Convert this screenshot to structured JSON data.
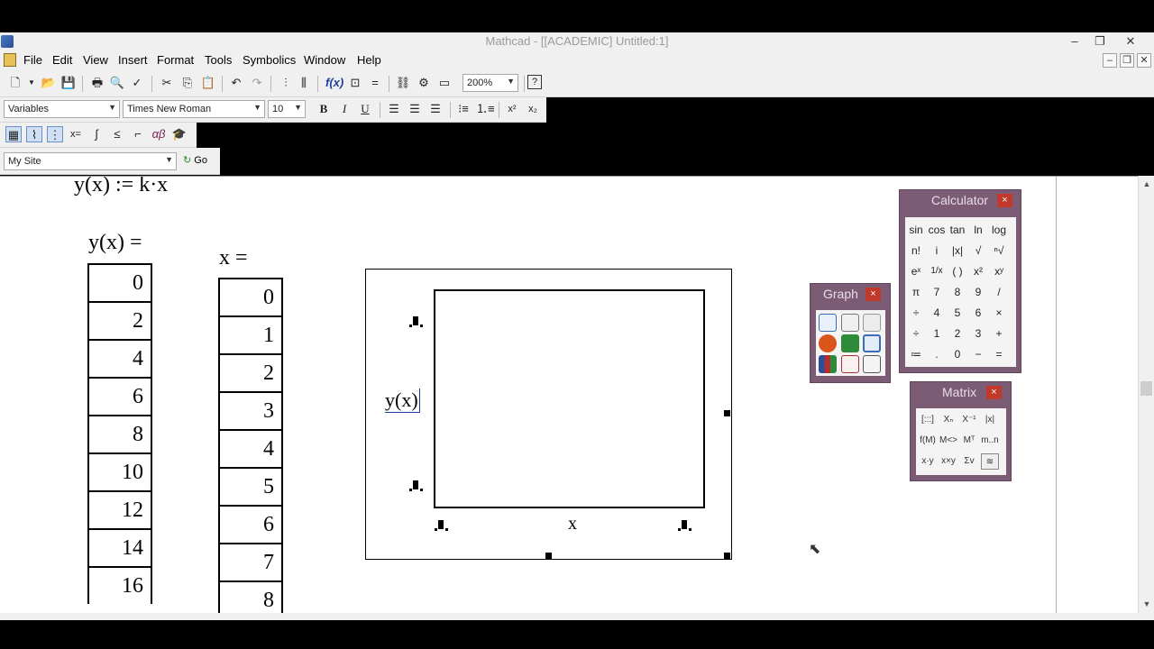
{
  "window": {
    "title": "Mathcad - [[ACADEMIC] Untitled:1]"
  },
  "menubar": {
    "items": [
      "File",
      "Edit",
      "View",
      "Insert",
      "Format",
      "Tools",
      "Symbolics",
      "Window",
      "Help"
    ]
  },
  "toolbar": {
    "zoom": "200%"
  },
  "formatting": {
    "style": "Variables",
    "font": "Times New Roman",
    "size": "10",
    "bold": "B",
    "italic": "I",
    "underline": "U"
  },
  "math_toolbar": {
    "items": [
      "calculator-icon",
      "graph-toolbar-icon",
      "matrix-toolbar-icon",
      "evaluation-icon",
      "calculus-icon",
      "boolean-icon",
      "programming-icon",
      "greek-icon",
      "symbolic-icon"
    ]
  },
  "resources": {
    "site": "My Site",
    "go_label": "Go"
  },
  "worksheet": {
    "definition": "y(x) := k·x",
    "y_eval_label": "y(x) =",
    "x_eval_label": "x =",
    "y_values": [
      "0",
      "2",
      "4",
      "6",
      "8",
      "10",
      "12",
      "14",
      "16"
    ],
    "x_values": [
      "0",
      "1",
      "2",
      "3",
      "4",
      "5",
      "6",
      "7",
      "8"
    ],
    "graph": {
      "y_axis_expr": "y(x)",
      "x_axis_expr": "x"
    }
  },
  "palettes": {
    "calculator": {
      "title": "Calculator",
      "rows": [
        [
          "sin",
          "cos",
          "tan",
          "ln",
          "log"
        ],
        [
          "n!",
          "i",
          "|x|",
          "√",
          "ⁿ√"
        ],
        [
          "eˣ",
          "1/x",
          "( )",
          "x²",
          "xʸ"
        ],
        [
          "π",
          "7",
          "8",
          "9",
          "/"
        ],
        [
          "÷",
          "4",
          "5",
          "6",
          "×"
        ],
        [
          "÷",
          "1",
          "2",
          "3",
          "+"
        ],
        [
          "≔",
          ".",
          "0",
          "−",
          "="
        ]
      ]
    },
    "graph": {
      "title": "Graph"
    },
    "matrix": {
      "title": "Matrix",
      "rows": [
        [
          "[:::]",
          "Xₙ",
          "X⁻¹",
          "|x|"
        ],
        [
          "f(M)",
          "M<>",
          "Mᵀ",
          "m..n"
        ],
        [
          "x·y",
          "x×y",
          "Σv",
          "≋"
        ]
      ]
    }
  },
  "close_glyph": "×"
}
